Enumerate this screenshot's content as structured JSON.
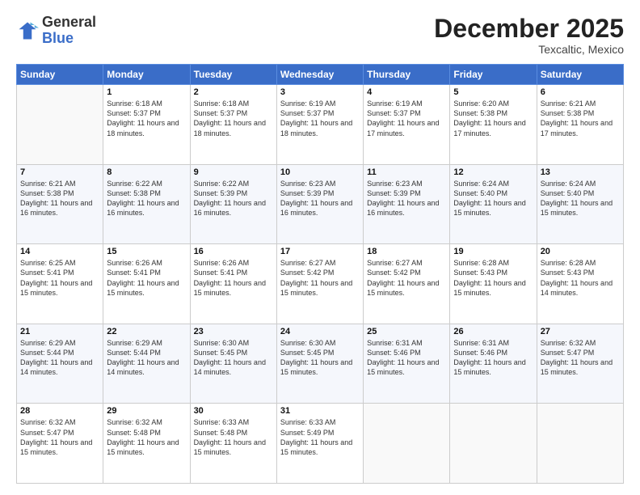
{
  "header": {
    "logo_general": "General",
    "logo_blue": "Blue",
    "month_title": "December 2025",
    "location": "Texcaltic, Mexico"
  },
  "weekdays": [
    "Sunday",
    "Monday",
    "Tuesday",
    "Wednesday",
    "Thursday",
    "Friday",
    "Saturday"
  ],
  "weeks": [
    [
      {
        "day": "",
        "sunrise": "",
        "sunset": "",
        "daylight": ""
      },
      {
        "day": "1",
        "sunrise": "Sunrise: 6:18 AM",
        "sunset": "Sunset: 5:37 PM",
        "daylight": "Daylight: 11 hours and 18 minutes."
      },
      {
        "day": "2",
        "sunrise": "Sunrise: 6:18 AM",
        "sunset": "Sunset: 5:37 PM",
        "daylight": "Daylight: 11 hours and 18 minutes."
      },
      {
        "day": "3",
        "sunrise": "Sunrise: 6:19 AM",
        "sunset": "Sunset: 5:37 PM",
        "daylight": "Daylight: 11 hours and 18 minutes."
      },
      {
        "day": "4",
        "sunrise": "Sunrise: 6:19 AM",
        "sunset": "Sunset: 5:37 PM",
        "daylight": "Daylight: 11 hours and 17 minutes."
      },
      {
        "day": "5",
        "sunrise": "Sunrise: 6:20 AM",
        "sunset": "Sunset: 5:38 PM",
        "daylight": "Daylight: 11 hours and 17 minutes."
      },
      {
        "day": "6",
        "sunrise": "Sunrise: 6:21 AM",
        "sunset": "Sunset: 5:38 PM",
        "daylight": "Daylight: 11 hours and 17 minutes."
      }
    ],
    [
      {
        "day": "7",
        "sunrise": "Sunrise: 6:21 AM",
        "sunset": "Sunset: 5:38 PM",
        "daylight": "Daylight: 11 hours and 16 minutes."
      },
      {
        "day": "8",
        "sunrise": "Sunrise: 6:22 AM",
        "sunset": "Sunset: 5:38 PM",
        "daylight": "Daylight: 11 hours and 16 minutes."
      },
      {
        "day": "9",
        "sunrise": "Sunrise: 6:22 AM",
        "sunset": "Sunset: 5:39 PM",
        "daylight": "Daylight: 11 hours and 16 minutes."
      },
      {
        "day": "10",
        "sunrise": "Sunrise: 6:23 AM",
        "sunset": "Sunset: 5:39 PM",
        "daylight": "Daylight: 11 hours and 16 minutes."
      },
      {
        "day": "11",
        "sunrise": "Sunrise: 6:23 AM",
        "sunset": "Sunset: 5:39 PM",
        "daylight": "Daylight: 11 hours and 16 minutes."
      },
      {
        "day": "12",
        "sunrise": "Sunrise: 6:24 AM",
        "sunset": "Sunset: 5:40 PM",
        "daylight": "Daylight: 11 hours and 15 minutes."
      },
      {
        "day": "13",
        "sunrise": "Sunrise: 6:24 AM",
        "sunset": "Sunset: 5:40 PM",
        "daylight": "Daylight: 11 hours and 15 minutes."
      }
    ],
    [
      {
        "day": "14",
        "sunrise": "Sunrise: 6:25 AM",
        "sunset": "Sunset: 5:41 PM",
        "daylight": "Daylight: 11 hours and 15 minutes."
      },
      {
        "day": "15",
        "sunrise": "Sunrise: 6:26 AM",
        "sunset": "Sunset: 5:41 PM",
        "daylight": "Daylight: 11 hours and 15 minutes."
      },
      {
        "day": "16",
        "sunrise": "Sunrise: 6:26 AM",
        "sunset": "Sunset: 5:41 PM",
        "daylight": "Daylight: 11 hours and 15 minutes."
      },
      {
        "day": "17",
        "sunrise": "Sunrise: 6:27 AM",
        "sunset": "Sunset: 5:42 PM",
        "daylight": "Daylight: 11 hours and 15 minutes."
      },
      {
        "day": "18",
        "sunrise": "Sunrise: 6:27 AM",
        "sunset": "Sunset: 5:42 PM",
        "daylight": "Daylight: 11 hours and 15 minutes."
      },
      {
        "day": "19",
        "sunrise": "Sunrise: 6:28 AM",
        "sunset": "Sunset: 5:43 PM",
        "daylight": "Daylight: 11 hours and 15 minutes."
      },
      {
        "day": "20",
        "sunrise": "Sunrise: 6:28 AM",
        "sunset": "Sunset: 5:43 PM",
        "daylight": "Daylight: 11 hours and 14 minutes."
      }
    ],
    [
      {
        "day": "21",
        "sunrise": "Sunrise: 6:29 AM",
        "sunset": "Sunset: 5:44 PM",
        "daylight": "Daylight: 11 hours and 14 minutes."
      },
      {
        "day": "22",
        "sunrise": "Sunrise: 6:29 AM",
        "sunset": "Sunset: 5:44 PM",
        "daylight": "Daylight: 11 hours and 14 minutes."
      },
      {
        "day": "23",
        "sunrise": "Sunrise: 6:30 AM",
        "sunset": "Sunset: 5:45 PM",
        "daylight": "Daylight: 11 hours and 14 minutes."
      },
      {
        "day": "24",
        "sunrise": "Sunrise: 6:30 AM",
        "sunset": "Sunset: 5:45 PM",
        "daylight": "Daylight: 11 hours and 15 minutes."
      },
      {
        "day": "25",
        "sunrise": "Sunrise: 6:31 AM",
        "sunset": "Sunset: 5:46 PM",
        "daylight": "Daylight: 11 hours and 15 minutes."
      },
      {
        "day": "26",
        "sunrise": "Sunrise: 6:31 AM",
        "sunset": "Sunset: 5:46 PM",
        "daylight": "Daylight: 11 hours and 15 minutes."
      },
      {
        "day": "27",
        "sunrise": "Sunrise: 6:32 AM",
        "sunset": "Sunset: 5:47 PM",
        "daylight": "Daylight: 11 hours and 15 minutes."
      }
    ],
    [
      {
        "day": "28",
        "sunrise": "Sunrise: 6:32 AM",
        "sunset": "Sunset: 5:47 PM",
        "daylight": "Daylight: 11 hours and 15 minutes."
      },
      {
        "day": "29",
        "sunrise": "Sunrise: 6:32 AM",
        "sunset": "Sunset: 5:48 PM",
        "daylight": "Daylight: 11 hours and 15 minutes."
      },
      {
        "day": "30",
        "sunrise": "Sunrise: 6:33 AM",
        "sunset": "Sunset: 5:48 PM",
        "daylight": "Daylight: 11 hours and 15 minutes."
      },
      {
        "day": "31",
        "sunrise": "Sunrise: 6:33 AM",
        "sunset": "Sunset: 5:49 PM",
        "daylight": "Daylight: 11 hours and 15 minutes."
      },
      {
        "day": "",
        "sunrise": "",
        "sunset": "",
        "daylight": ""
      },
      {
        "day": "",
        "sunrise": "",
        "sunset": "",
        "daylight": ""
      },
      {
        "day": "",
        "sunrise": "",
        "sunset": "",
        "daylight": ""
      }
    ]
  ]
}
